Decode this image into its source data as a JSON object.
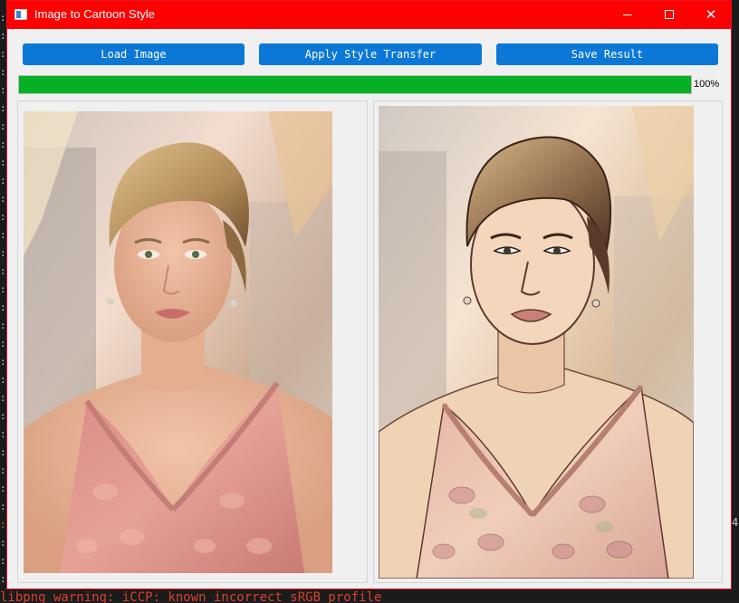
{
  "window": {
    "title": "Image to Cartoon Style"
  },
  "title_controls": {
    "minimize_icon": "minimize-icon",
    "maximize_icon": "maximize-icon",
    "close_icon": "close-icon",
    "close_glyph": "✕"
  },
  "toolbar": {
    "load_label": "Load Image",
    "apply_label": "Apply Style Transfer",
    "save_label": "Save Result"
  },
  "progress": {
    "value": 100,
    "label": "100%"
  },
  "colors": {
    "titlebar": "#ff0000",
    "button": "#0b78d7",
    "progress": "#06b025",
    "terminal_error": "#d9422c"
  },
  "terminal": {
    "bottom_line": "libpng warning: iCCP: known incorrect sRGB profile",
    "right_char": "4"
  }
}
